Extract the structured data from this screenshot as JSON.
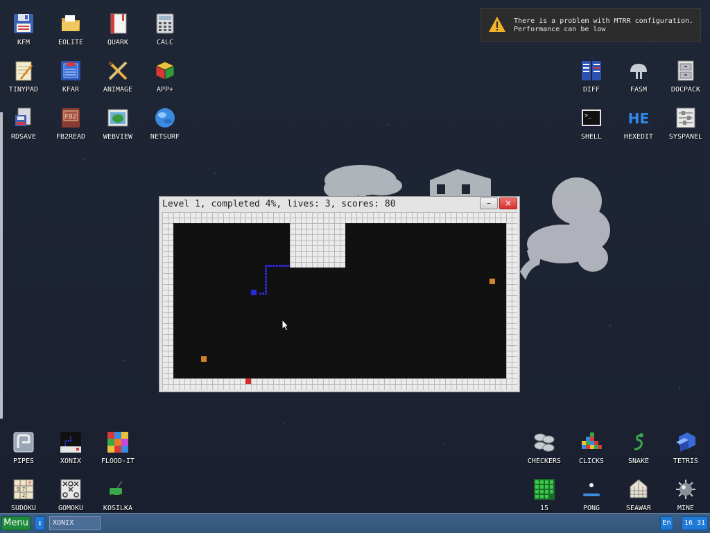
{
  "desktop": {
    "icons_top_left": [
      {
        "label": "KFM",
        "icon": "floppy-icon"
      },
      {
        "label": "EOLITE",
        "icon": "folder-icon"
      },
      {
        "label": "QUARK",
        "icon": "notebook-icon"
      },
      {
        "label": "CALC",
        "icon": "calculator-icon"
      },
      {
        "label": "TINYPAD",
        "icon": "notepad-icon"
      },
      {
        "label": "KFAR",
        "icon": "archive-icon"
      },
      {
        "label": "ANIMAGE",
        "icon": "paint-tools-icon"
      },
      {
        "label": "APP+",
        "icon": "rubik-cube-icon"
      },
      {
        "label": "RDSAVE",
        "icon": "ramdisk-save-icon"
      },
      {
        "label": "FB2READ",
        "icon": "book-icon"
      },
      {
        "label": "WEBVIEW",
        "icon": "browser-icon"
      },
      {
        "label": "NETSURF",
        "icon": "globe-icon"
      }
    ],
    "icons_top_right": [
      {
        "label": "DIFF",
        "icon": "diff-icon"
      },
      {
        "label": "FASM",
        "icon": "assembler-icon"
      },
      {
        "label": "DOCPACK",
        "icon": "docpack-icon"
      },
      {
        "label": "SHELL",
        "icon": "terminal-icon"
      },
      {
        "label": "HEXEDIT",
        "icon": "hex-editor-icon"
      },
      {
        "label": "SYSPANEL",
        "icon": "sliders-icon"
      }
    ],
    "icons_bottom_left": [
      {
        "label": "PIPES",
        "icon": "pipes-icon"
      },
      {
        "label": "XONIX",
        "icon": "xonix-icon"
      },
      {
        "label": "FLOOD-IT",
        "icon": "flood-it-icon"
      },
      {
        "label": "SUDOKU",
        "icon": "sudoku-icon"
      },
      {
        "label": "GOMOKU",
        "icon": "gomoku-icon"
      },
      {
        "label": "KOSILKA",
        "icon": "lawn-mower-icon"
      }
    ],
    "icons_bottom_right": [
      {
        "label": "CHECKERS",
        "icon": "checkers-icon"
      },
      {
        "label": "CLICKS",
        "icon": "clicks-icon"
      },
      {
        "label": "SNAKE",
        "icon": "snake-icon"
      },
      {
        "label": "TETRIS",
        "icon": "tetris-icon"
      },
      {
        "label": "15",
        "icon": "fifteen-puzzle-icon"
      },
      {
        "label": "PONG",
        "icon": "pong-icon"
      },
      {
        "label": "SEAWAR",
        "icon": "seawar-icon"
      },
      {
        "label": "MINE",
        "icon": "mine-icon"
      }
    ]
  },
  "notification": {
    "line1": "There is a problem with MTRR configuration.",
    "line2": "Performance can be low",
    "icon": "warning-icon",
    "accent": "#f2b22a"
  },
  "game_window": {
    "title": "Level 1, completed 4%, lives: 3, scores: 80",
    "minimize_label": "–",
    "close_label": "×",
    "close_color": "#d53030"
  },
  "taskbar": {
    "menu_label": "Menu",
    "switch_label": "↕",
    "task_label": "XONIX",
    "lang": "En",
    "clock": "16 31",
    "menu_color": "#1f8a3a",
    "accent": "#1f7ad8"
  }
}
